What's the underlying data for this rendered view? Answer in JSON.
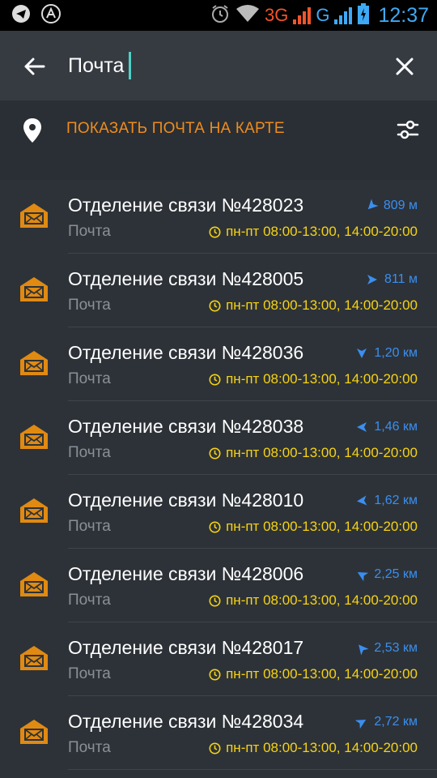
{
  "status_bar": {
    "icons_left": [
      "telegram-icon",
      "a-circle-icon"
    ],
    "icons_right": [
      "alarm-icon",
      "wifi-icon",
      "signal-icon",
      "signal-icon",
      "battery-icon"
    ],
    "network_1": "3G",
    "network_2": "G",
    "time": "12:37"
  },
  "search": {
    "query": "Почта",
    "back_icon": "arrow-left-icon",
    "clear_icon": "close-icon"
  },
  "map_row": {
    "label": "ПОКАЗАТЬ ПОЧТА НА КАРТЕ",
    "pin_icon": "location-pin-icon",
    "filter_icon": "sliders-icon",
    "accent": "#f08c1c"
  },
  "results": [
    {
      "title": "Отделение связи №428023",
      "category": "Почта",
      "distance": "809 м",
      "hours": "пн-пт 08:00-13:00, 14:00-20:00",
      "bearing": 225
    },
    {
      "title": "Отделение связи №428005",
      "category": "Почта",
      "distance": "811 м",
      "hours": "пн-пт 08:00-13:00, 14:00-20:00",
      "bearing": 90
    },
    {
      "title": "Отделение связи №428036",
      "category": "Почта",
      "distance": "1,20 км",
      "hours": "пн-пт 08:00-13:00, 14:00-20:00",
      "bearing": 180
    },
    {
      "title": "Отделение связи №428038",
      "category": "Почта",
      "distance": "1,46 км",
      "hours": "пн-пт 08:00-13:00, 14:00-20:00",
      "bearing": 270
    },
    {
      "title": "Отделение связи №428010",
      "category": "Почта",
      "distance": "1,62 км",
      "hours": "пн-пт 08:00-13:00, 14:00-20:00",
      "bearing": 265
    },
    {
      "title": "Отделение связи №428006",
      "category": "Почта",
      "distance": "2,25 км",
      "hours": "пн-пт 08:00-13:00, 14:00-20:00",
      "bearing": 300
    },
    {
      "title": "Отделение связи №428017",
      "category": "Почта",
      "distance": "2,53 км",
      "hours": "пн-пт 08:00-13:00, 14:00-20:00",
      "bearing": 320
    },
    {
      "title": "Отделение связи №428034",
      "category": "Почта",
      "distance": "2,72 км",
      "hours": "пн-пт 08:00-13:00, 14:00-20:00",
      "bearing": 60
    }
  ],
  "colors": {
    "distance": "#3a8ff0",
    "hours": "#f6d313",
    "mail_icon": "#e08a12"
  }
}
